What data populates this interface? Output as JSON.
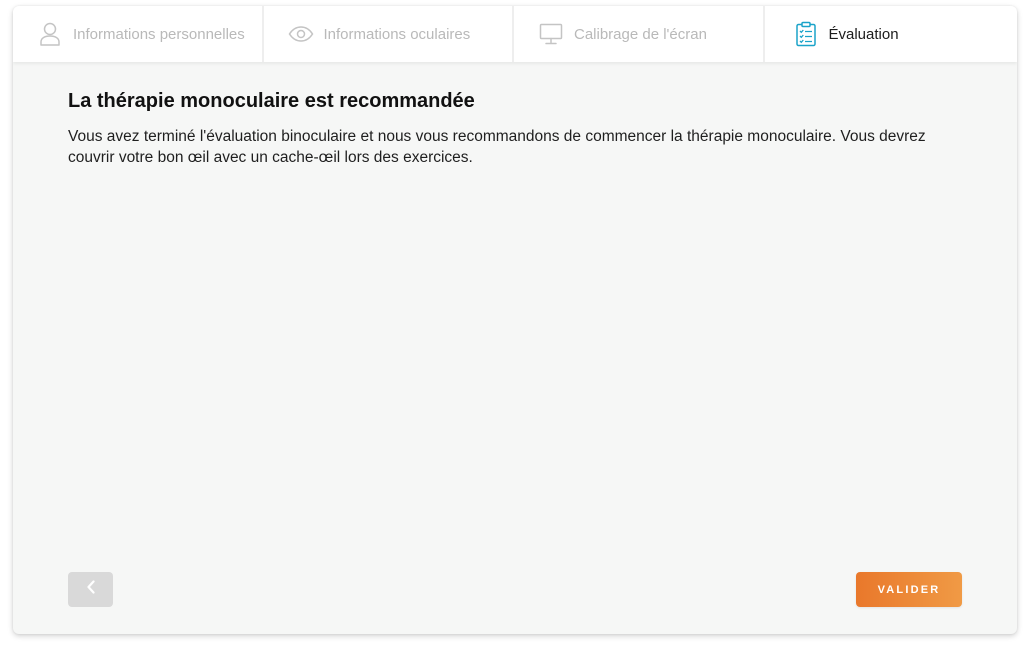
{
  "steps": [
    {
      "label": "Informations personnelles",
      "icon": "user-icon",
      "active": false
    },
    {
      "label": "Informations oculaires",
      "icon": "eye-icon",
      "active": false
    },
    {
      "label": "Calibrage de l'écran",
      "icon": "monitor-icon",
      "active": false
    },
    {
      "label": "Évaluation",
      "icon": "clipboard-checklist-icon",
      "active": true
    }
  ],
  "main": {
    "title": "La thérapie monoculaire est recommandée",
    "description": "Vous avez terminé l'évaluation binoculaire et nous vous recommandons de commencer la thérapie monoculaire. Vous devrez couvrir votre bon œil avec un cache-œil lors des exercices."
  },
  "footer": {
    "back_icon": "chevron-left-icon",
    "validate_label": "VALIDER"
  },
  "colors": {
    "accent": "#e9782b",
    "active_icon": "#1aa3c9",
    "inactive": "#b9b9b9",
    "back_button": "#d9d9d9"
  }
}
